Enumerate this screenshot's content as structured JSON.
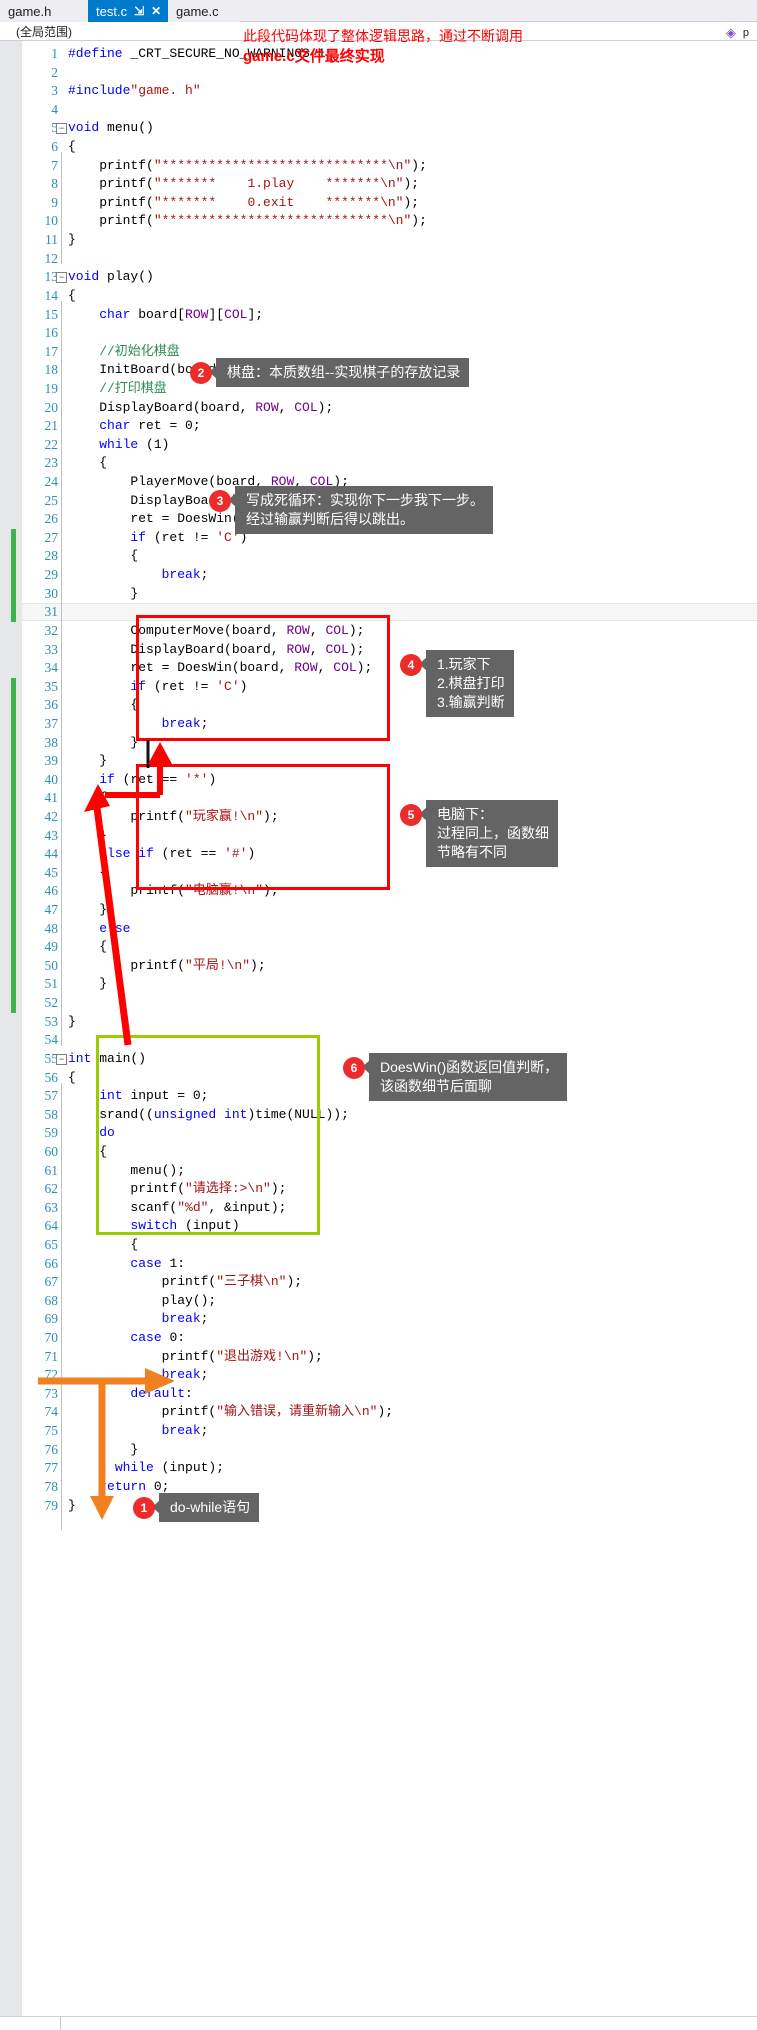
{
  "window": {
    "tabs": [
      {
        "label": "game.h",
        "active": false,
        "name": "tab-game-h"
      },
      {
        "label": "test.c",
        "active": true,
        "pin": "⇲",
        "close": "✕",
        "name": "tab-test-c"
      },
      {
        "label": "game.c",
        "active": false,
        "name": "tab-game-c"
      }
    ],
    "scope": "(全局范围)",
    "marker_label": "p"
  },
  "annotations_top": {
    "line1": "此段代码体现了整体逻辑思路，通过不断调用",
    "line2": "game.c文件最终实现"
  },
  "callouts": [
    {
      "n": "1",
      "text": "do-while语句",
      "name": "callout-1-do-while"
    },
    {
      "n": "2",
      "text": "棋盘：本质数组--实现棋子的存放记录",
      "name": "callout-2-board"
    },
    {
      "n": "3",
      "text": "写成死循环：实现你下一步我下一步。\n经过输赢判断后得以跳出。",
      "name": "callout-3-infinite-loop"
    },
    {
      "n": "4",
      "text": "1.玩家下\n2.棋盘打印\n3.输赢判断",
      "name": "callout-4-player-steps"
    },
    {
      "n": "5",
      "text": "电脑下：\n过程同上，函数细\n节略有不同",
      "name": "callout-5-computer-steps"
    },
    {
      "n": "6",
      "text": "DoesWin()函数返回值判断，\n该函数细节后面聊",
      "name": "callout-6-doeswin"
    }
  ],
  "colors": {
    "accent_tab": "#007acc",
    "callout_bullet": "#ee2b2b",
    "callout_body": "#646464",
    "box_red": "#ff0000",
    "box_green": "#9acd00",
    "arrow_orange": "#f08020",
    "arrow_red": "#ff0000",
    "linenumber": "#2b91af",
    "keyword": "#0000ff",
    "string": "#a31515",
    "comment": "#2e8b57",
    "macro": "#6f008a",
    "changebar": "#3fb34f"
  },
  "code": [
    {
      "n": 1,
      "segs": [
        {
          "t": "#define ",
          "c": "pp"
        },
        {
          "t": "_CRT_SECURE_NO_WARNINGS 1",
          "c": "fn"
        }
      ]
    },
    {
      "n": 2,
      "segs": []
    },
    {
      "n": 3,
      "segs": [
        {
          "t": "#include",
          "c": "pp"
        },
        {
          "t": "\"game. h\"",
          "c": "str"
        }
      ]
    },
    {
      "n": 4,
      "segs": []
    },
    {
      "n": 5,
      "segs": [
        {
          "t": "void ",
          "c": "kw"
        },
        {
          "t": "menu()",
          "c": "fn"
        }
      ],
      "fold": true
    },
    {
      "n": 6,
      "segs": [
        {
          "t": "{",
          "c": "fn"
        }
      ]
    },
    {
      "n": 7,
      "segs": [
        {
          "t": "    printf(",
          "c": "fn"
        },
        {
          "t": "\"*****************************\\n\"",
          "c": "str"
        },
        {
          "t": ");",
          "c": "fn"
        }
      ]
    },
    {
      "n": 8,
      "segs": [
        {
          "t": "    printf(",
          "c": "fn"
        },
        {
          "t": "\"*******    1.play    *******\\n\"",
          "c": "str"
        },
        {
          "t": ");",
          "c": "fn"
        }
      ]
    },
    {
      "n": 9,
      "segs": [
        {
          "t": "    printf(",
          "c": "fn"
        },
        {
          "t": "\"*******    0.exit    *******\\n\"",
          "c": "str"
        },
        {
          "t": ");",
          "c": "fn"
        }
      ]
    },
    {
      "n": 10,
      "segs": [
        {
          "t": "    printf(",
          "c": "fn"
        },
        {
          "t": "\"*****************************\\n\"",
          "c": "str"
        },
        {
          "t": ");",
          "c": "fn"
        }
      ]
    },
    {
      "n": 11,
      "segs": [
        {
          "t": "}",
          "c": "fn"
        }
      ]
    },
    {
      "n": 12,
      "segs": []
    },
    {
      "n": 13,
      "segs": [
        {
          "t": "void ",
          "c": "kw"
        },
        {
          "t": "play()",
          "c": "fn"
        }
      ],
      "fold": true
    },
    {
      "n": 14,
      "segs": [
        {
          "t": "{",
          "c": "fn"
        }
      ]
    },
    {
      "n": 15,
      "segs": [
        {
          "t": "    ",
          "c": "fn"
        },
        {
          "t": "char ",
          "c": "kw"
        },
        {
          "t": "board[",
          "c": "fn"
        },
        {
          "t": "ROW",
          "c": "mac"
        },
        {
          "t": "][",
          "c": "fn"
        },
        {
          "t": "COL",
          "c": "mac"
        },
        {
          "t": "];",
          "c": "fn"
        }
      ]
    },
    {
      "n": 16,
      "segs": []
    },
    {
      "n": 17,
      "segs": [
        {
          "t": "    //初始化棋盘",
          "c": "cm"
        }
      ]
    },
    {
      "n": 18,
      "segs": [
        {
          "t": "    InitBoard(board, ",
          "c": "fn"
        },
        {
          "t": "ROW",
          "c": "mac"
        },
        {
          "t": ", ",
          "c": "fn"
        },
        {
          "t": "COL",
          "c": "mac"
        },
        {
          "t": ");",
          "c": "fn"
        }
      ]
    },
    {
      "n": 19,
      "segs": [
        {
          "t": "    //打印棋盘",
          "c": "cm"
        }
      ]
    },
    {
      "n": 20,
      "segs": [
        {
          "t": "    DisplayBoard(board, ",
          "c": "fn"
        },
        {
          "t": "ROW",
          "c": "mac"
        },
        {
          "t": ", ",
          "c": "fn"
        },
        {
          "t": "COL",
          "c": "mac"
        },
        {
          "t": ");",
          "c": "fn"
        }
      ]
    },
    {
      "n": 21,
      "segs": [
        {
          "t": "    ",
          "c": "fn"
        },
        {
          "t": "char ",
          "c": "kw"
        },
        {
          "t": "ret = 0;",
          "c": "fn"
        }
      ]
    },
    {
      "n": 22,
      "segs": [
        {
          "t": "    ",
          "c": "fn"
        },
        {
          "t": "while ",
          "c": "kw"
        },
        {
          "t": "(1)",
          "c": "fn"
        }
      ]
    },
    {
      "n": 23,
      "segs": [
        {
          "t": "    {",
          "c": "fn"
        }
      ]
    },
    {
      "n": 24,
      "segs": [
        {
          "t": "        PlayerMove(board, ",
          "c": "fn"
        },
        {
          "t": "ROW",
          "c": "mac"
        },
        {
          "t": ", ",
          "c": "fn"
        },
        {
          "t": "COL",
          "c": "mac"
        },
        {
          "t": ");",
          "c": "fn"
        }
      ]
    },
    {
      "n": 25,
      "segs": [
        {
          "t": "        DisplayBoard(board, ",
          "c": "fn"
        },
        {
          "t": "ROW",
          "c": "mac"
        },
        {
          "t": ", ",
          "c": "fn"
        },
        {
          "t": "COL",
          "c": "mac"
        },
        {
          "t": ");",
          "c": "fn"
        }
      ]
    },
    {
      "n": 26,
      "segs": [
        {
          "t": "        ret = DoesWin(board, ",
          "c": "fn"
        },
        {
          "t": "ROW",
          "c": "mac"
        },
        {
          "t": ", ",
          "c": "fn"
        },
        {
          "t": "COL",
          "c": "mac"
        },
        {
          "t": ");",
          "c": "fn"
        }
      ]
    },
    {
      "n": 27,
      "segs": [
        {
          "t": "        ",
          "c": "fn"
        },
        {
          "t": "if ",
          "c": "kw"
        },
        {
          "t": "(ret != ",
          "c": "fn"
        },
        {
          "t": "'C'",
          "c": "str"
        },
        {
          "t": ")",
          "c": "fn"
        }
      ],
      "chg": true
    },
    {
      "n": 28,
      "segs": [
        {
          "t": "        {",
          "c": "fn"
        }
      ],
      "chg": true
    },
    {
      "n": 29,
      "segs": [
        {
          "t": "            ",
          "c": "fn"
        },
        {
          "t": "break",
          "c": "kw"
        },
        {
          "t": ";",
          "c": "fn"
        }
      ],
      "chg": true
    },
    {
      "n": 30,
      "segs": [
        {
          "t": "        }",
          "c": "fn"
        }
      ],
      "chg": true
    },
    {
      "n": 31,
      "segs": [
        {
          "t": "",
          "c": "fn"
        }
      ],
      "chg": true,
      "cur": true
    },
    {
      "n": 32,
      "segs": [
        {
          "t": "        ComputerMove(board, ",
          "c": "fn"
        },
        {
          "t": "ROW",
          "c": "mac"
        },
        {
          "t": ", ",
          "c": "fn"
        },
        {
          "t": "COL",
          "c": "mac"
        },
        {
          "t": ");",
          "c": "fn"
        }
      ]
    },
    {
      "n": 33,
      "segs": [
        {
          "t": "        DisplayBoard(board, ",
          "c": "fn"
        },
        {
          "t": "ROW",
          "c": "mac"
        },
        {
          "t": ", ",
          "c": "fn"
        },
        {
          "t": "COL",
          "c": "mac"
        },
        {
          "t": ");",
          "c": "fn"
        }
      ]
    },
    {
      "n": 34,
      "segs": [
        {
          "t": "        ret = DoesWin(board, ",
          "c": "fn"
        },
        {
          "t": "ROW",
          "c": "mac"
        },
        {
          "t": ", ",
          "c": "fn"
        },
        {
          "t": "COL",
          "c": "mac"
        },
        {
          "t": ");",
          "c": "fn"
        }
      ]
    },
    {
      "n": 35,
      "segs": [
        {
          "t": "        ",
          "c": "fn"
        },
        {
          "t": "if ",
          "c": "kw"
        },
        {
          "t": "(ret != ",
          "c": "fn"
        },
        {
          "t": "'C'",
          "c": "str"
        },
        {
          "t": ")",
          "c": "fn"
        }
      ],
      "chg": true
    },
    {
      "n": 36,
      "segs": [
        {
          "t": "        {",
          "c": "fn"
        }
      ],
      "chg": true
    },
    {
      "n": 37,
      "segs": [
        {
          "t": "            ",
          "c": "fn"
        },
        {
          "t": "break",
          "c": "kw"
        },
        {
          "t": ";",
          "c": "fn"
        }
      ],
      "chg": true
    },
    {
      "n": 38,
      "segs": [
        {
          "t": "        }",
          "c": "fn"
        }
      ],
      "chg": true
    },
    {
      "n": 39,
      "segs": [
        {
          "t": "    }",
          "c": "fn"
        }
      ],
      "chg": true
    },
    {
      "n": 40,
      "segs": [
        {
          "t": "    ",
          "c": "fn"
        },
        {
          "t": "if ",
          "c": "kw"
        },
        {
          "t": "(ret == ",
          "c": "fn"
        },
        {
          "t": "'*'",
          "c": "str"
        },
        {
          "t": ")",
          "c": "fn"
        }
      ],
      "chg": true
    },
    {
      "n": 41,
      "segs": [
        {
          "t": "    {",
          "c": "fn"
        }
      ],
      "chg": true
    },
    {
      "n": 42,
      "segs": [
        {
          "t": "        printf(",
          "c": "fn"
        },
        {
          "t": "\"玩家赢!\\n\"",
          "c": "str"
        },
        {
          "t": ");",
          "c": "fn"
        }
      ],
      "chg": true
    },
    {
      "n": 43,
      "segs": [
        {
          "t": "    }",
          "c": "fn"
        }
      ],
      "chg": true
    },
    {
      "n": 44,
      "segs": [
        {
          "t": "    ",
          "c": "fn"
        },
        {
          "t": "else if ",
          "c": "kw"
        },
        {
          "t": "(ret == ",
          "c": "fn"
        },
        {
          "t": "'#'",
          "c": "str"
        },
        {
          "t": ")",
          "c": "fn"
        }
      ],
      "chg": true
    },
    {
      "n": 45,
      "segs": [
        {
          "t": "    {",
          "c": "fn"
        }
      ],
      "chg": true
    },
    {
      "n": 46,
      "segs": [
        {
          "t": "        printf(",
          "c": "fn"
        },
        {
          "t": "\"电脑赢!\\n\"",
          "c": "str"
        },
        {
          "t": ");",
          "c": "fn"
        }
      ],
      "chg": true
    },
    {
      "n": 47,
      "segs": [
        {
          "t": "    }",
          "c": "fn"
        }
      ],
      "chg": true
    },
    {
      "n": 48,
      "segs": [
        {
          "t": "    ",
          "c": "fn"
        },
        {
          "t": "else",
          "c": "kw"
        }
      ],
      "chg": true
    },
    {
      "n": 49,
      "segs": [
        {
          "t": "    {",
          "c": "fn"
        }
      ],
      "chg": true
    },
    {
      "n": 50,
      "segs": [
        {
          "t": "        printf(",
          "c": "fn"
        },
        {
          "t": "\"平局!\\n\"",
          "c": "str"
        },
        {
          "t": ");",
          "c": "fn"
        }
      ],
      "chg": true
    },
    {
      "n": 51,
      "segs": [
        {
          "t": "    }",
          "c": "fn"
        }
      ],
      "chg": true
    },
    {
      "n": 52,
      "segs": [],
      "chg": true
    },
    {
      "n": 53,
      "segs": [
        {
          "t": "}",
          "c": "fn"
        }
      ]
    },
    {
      "n": 54,
      "segs": []
    },
    {
      "n": 55,
      "segs": [
        {
          "t": "int ",
          "c": "kw"
        },
        {
          "t": "main()",
          "c": "fn"
        }
      ],
      "fold": true
    },
    {
      "n": 56,
      "segs": [
        {
          "t": "{",
          "c": "fn"
        }
      ]
    },
    {
      "n": 57,
      "segs": [
        {
          "t": "    ",
          "c": "fn"
        },
        {
          "t": "int ",
          "c": "kw"
        },
        {
          "t": "input = 0;",
          "c": "fn"
        }
      ]
    },
    {
      "n": 58,
      "segs": [
        {
          "t": "    srand((",
          "c": "fn"
        },
        {
          "t": "unsigned int",
          "c": "kw"
        },
        {
          "t": ")time(NULL));",
          "c": "fn"
        }
      ]
    },
    {
      "n": 59,
      "segs": [
        {
          "t": "    ",
          "c": "fn"
        },
        {
          "t": "do",
          "c": "kw"
        }
      ]
    },
    {
      "n": 60,
      "segs": [
        {
          "t": "    {",
          "c": "fn"
        }
      ]
    },
    {
      "n": 61,
      "segs": [
        {
          "t": "        menu();",
          "c": "fn"
        }
      ]
    },
    {
      "n": 62,
      "segs": [
        {
          "t": "        printf(",
          "c": "fn"
        },
        {
          "t": "\"请选择:>\\n\"",
          "c": "str"
        },
        {
          "t": ");",
          "c": "fn"
        }
      ]
    },
    {
      "n": 63,
      "segs": [
        {
          "t": "        scanf(",
          "c": "fn"
        },
        {
          "t": "\"%d\"",
          "c": "str"
        },
        {
          "t": ", &input);",
          "c": "fn"
        }
      ]
    },
    {
      "n": 64,
      "segs": [
        {
          "t": "        ",
          "c": "fn"
        },
        {
          "t": "switch ",
          "c": "kw"
        },
        {
          "t": "(input)",
          "c": "fn"
        }
      ]
    },
    {
      "n": 65,
      "segs": [
        {
          "t": "        {",
          "c": "fn"
        }
      ]
    },
    {
      "n": 66,
      "segs": [
        {
          "t": "        ",
          "c": "fn"
        },
        {
          "t": "case ",
          "c": "kw"
        },
        {
          "t": "1:",
          "c": "fn"
        }
      ]
    },
    {
      "n": 67,
      "segs": [
        {
          "t": "            printf(",
          "c": "fn"
        },
        {
          "t": "\"三子棋\\n\"",
          "c": "str"
        },
        {
          "t": ");",
          "c": "fn"
        }
      ]
    },
    {
      "n": 68,
      "segs": [
        {
          "t": "            play();",
          "c": "fn"
        }
      ]
    },
    {
      "n": 69,
      "segs": [
        {
          "t": "            ",
          "c": "fn"
        },
        {
          "t": "break",
          "c": "kw"
        },
        {
          "t": ";",
          "c": "fn"
        }
      ]
    },
    {
      "n": 70,
      "segs": [
        {
          "t": "        ",
          "c": "fn"
        },
        {
          "t": "case ",
          "c": "kw"
        },
        {
          "t": "0:",
          "c": "fn"
        }
      ]
    },
    {
      "n": 71,
      "segs": [
        {
          "t": "            printf(",
          "c": "fn"
        },
        {
          "t": "\"退出游戏!\\n\"",
          "c": "str"
        },
        {
          "t": ");",
          "c": "fn"
        }
      ]
    },
    {
      "n": 72,
      "segs": [
        {
          "t": "            ",
          "c": "fn"
        },
        {
          "t": "break",
          "c": "kw"
        },
        {
          "t": ";",
          "c": "fn"
        }
      ]
    },
    {
      "n": 73,
      "segs": [
        {
          "t": "        ",
          "c": "fn"
        },
        {
          "t": "default",
          "c": "kw"
        },
        {
          "t": ":",
          "c": "fn"
        }
      ]
    },
    {
      "n": 74,
      "segs": [
        {
          "t": "            printf(",
          "c": "fn"
        },
        {
          "t": "\"输入错误，请重新输入\\n\"",
          "c": "str"
        },
        {
          "t": ");",
          "c": "fn"
        }
      ]
    },
    {
      "n": 75,
      "segs": [
        {
          "t": "            ",
          "c": "fn"
        },
        {
          "t": "break",
          "c": "kw"
        },
        {
          "t": ";",
          "c": "fn"
        }
      ]
    },
    {
      "n": 76,
      "segs": [
        {
          "t": "        }",
          "c": "fn"
        }
      ]
    },
    {
      "n": 77,
      "segs": [
        {
          "t": "    } ",
          "c": "fn"
        },
        {
          "t": "while ",
          "c": "kw"
        },
        {
          "t": "(input);",
          "c": "fn"
        }
      ]
    },
    {
      "n": 78,
      "segs": [
        {
          "t": "    ",
          "c": "fn"
        },
        {
          "t": "return ",
          "c": "kw"
        },
        {
          "t": "0;",
          "c": "fn"
        }
      ]
    },
    {
      "n": 79,
      "segs": [
        {
          "t": "}",
          "c": "fn"
        }
      ]
    }
  ]
}
